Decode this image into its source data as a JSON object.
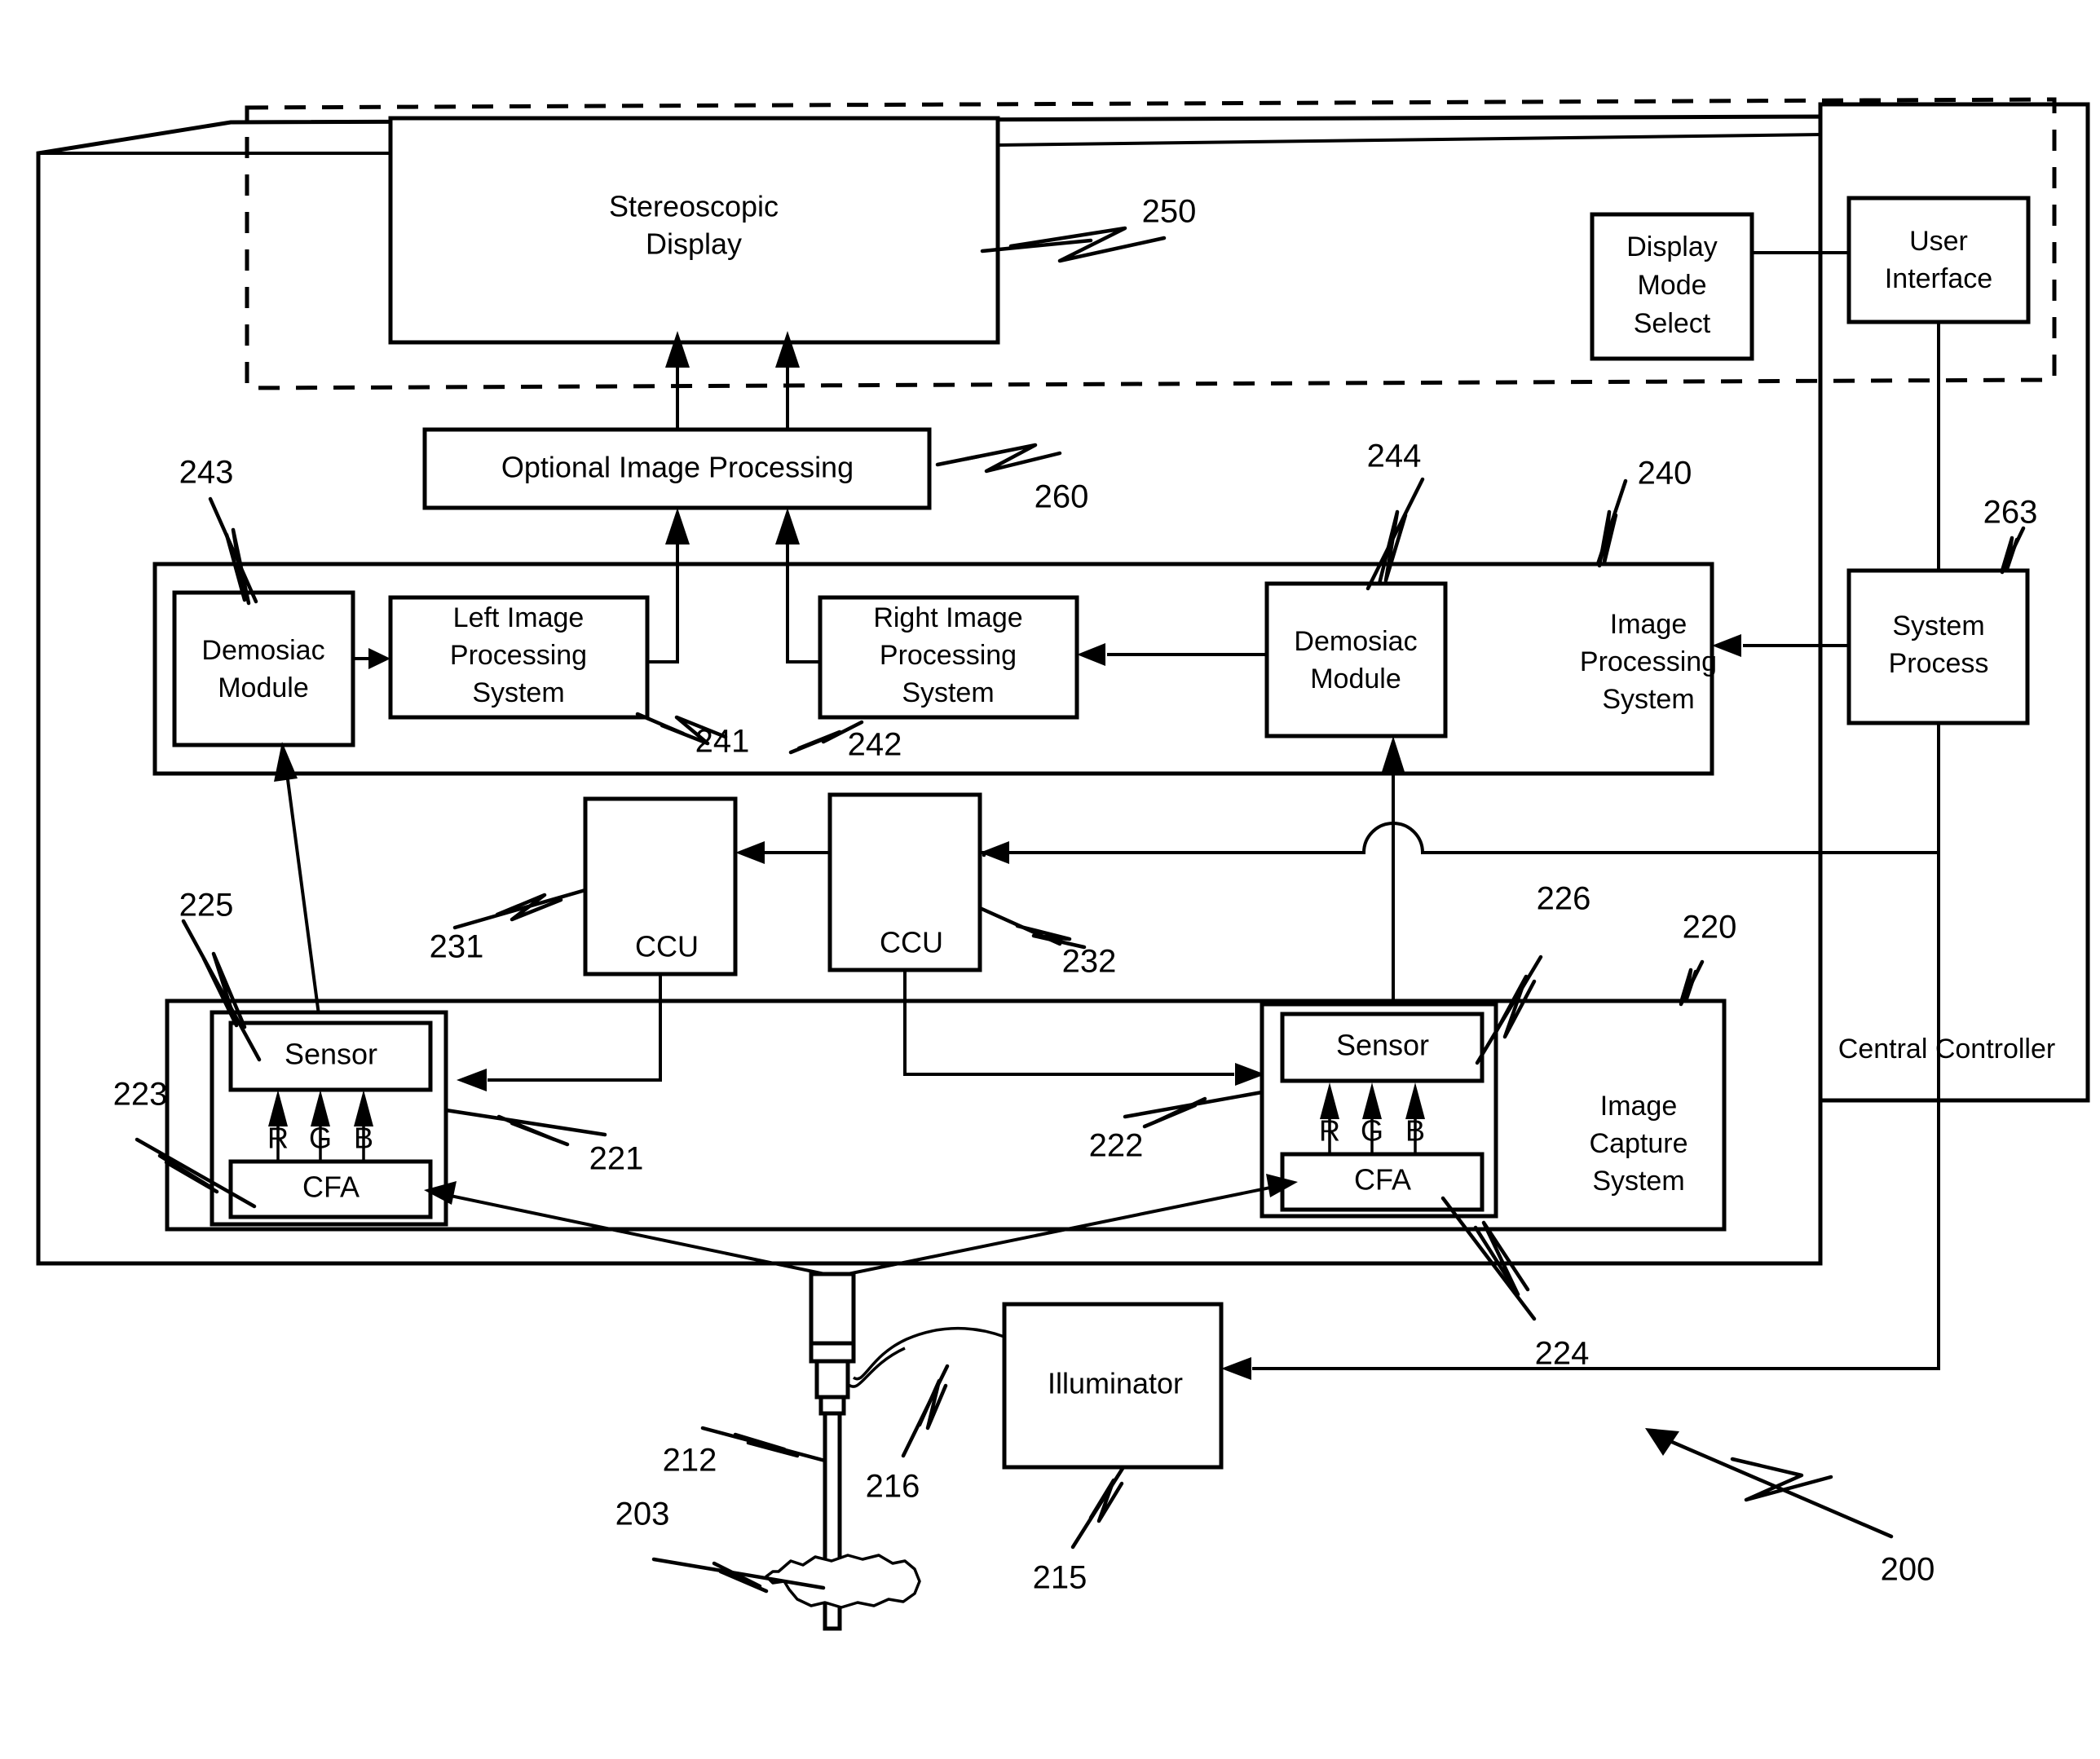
{
  "figure": {
    "title": "Stereoscopic Endoscopic Imaging System Block Diagram",
    "system_ref": "200"
  },
  "blocks": {
    "stereoscopic_display": "Stereoscopic\nDisplay",
    "stereoscopic_display_line1": "Stereoscopic",
    "stereoscopic_display_line2": "Display",
    "display_mode_select_line1": "Display",
    "display_mode_select_line2": "Mode",
    "display_mode_select_line3": "Select",
    "user_interface_line1": "User",
    "user_interface_line2": "Interface",
    "optional_image_processing": "Optional Image Processing",
    "demosiac_left_line1": "Demosiac",
    "demosiac_left_line2": "Module",
    "demosiac_right_line1": "Demosiac",
    "demosiac_right_line2": "Module",
    "left_image_processing_line1": "Left Image",
    "left_image_processing_line2": "Processing",
    "left_image_processing_line3": "System",
    "right_image_processing_line1": "Right Image",
    "right_image_processing_line2": "Processing",
    "right_image_processing_line3": "System",
    "image_processing_system_line1": "Image",
    "image_processing_system_line2": "Processing",
    "image_processing_system_line3": "System",
    "system_process_line1": "System",
    "system_process_line2": "Process",
    "ccu_left": "CCU",
    "ccu_right": "CCU",
    "sensor_left": "Sensor",
    "sensor_right": "Sensor",
    "cfa_left": "CFA",
    "cfa_right": "CFA",
    "image_capture_system_line1": "Image",
    "image_capture_system_line2": "Capture",
    "image_capture_system_line3": "System",
    "central_controller": "Central Controller",
    "illuminator": "Illuminator"
  },
  "channels": {
    "left": {
      "r": "R",
      "g": "G",
      "b": "B"
    },
    "right": {
      "r": "R",
      "g": "G",
      "b": "B"
    }
  },
  "reference_numerals": {
    "display": "250",
    "optional_processing": "260",
    "left_image_processing": "241",
    "right_image_processing": "242",
    "demosiac_left": "243",
    "demosiac_right": "244",
    "image_processing_system": "240",
    "system_process": "263",
    "ccu_left": "231",
    "ccu_right": "232",
    "sensor_left": "225",
    "sensor_right": "226",
    "camera_left": "221",
    "camera_right": "222",
    "cfa_left": "223",
    "cfa_right": "224",
    "image_capture_system": "220",
    "illuminator": "215",
    "light_guide": "216",
    "endoscope": "212",
    "tissue": "203",
    "system": "200"
  }
}
